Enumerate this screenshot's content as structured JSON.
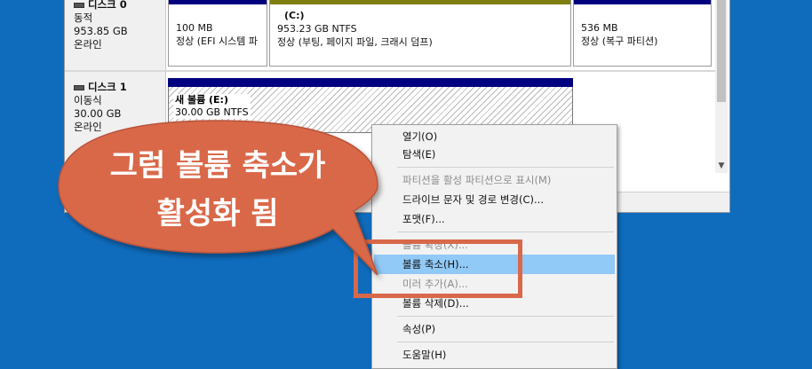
{
  "disk0": {
    "title": "디스크 0",
    "type": "동적",
    "size": "953.85 GB",
    "status": "온라인",
    "partitions": [
      {
        "label": "",
        "size": "100 MB",
        "desc": "정상 (EFI 시스템 파"
      },
      {
        "label": "(C:)",
        "size": "953.23 GB NTFS",
        "desc": "정상 (부팅, 페이지 파일, 크래시 덤프)"
      },
      {
        "label": "",
        "size": "536 MB",
        "desc": "정상 (복구 파티션)"
      }
    ]
  },
  "disk1": {
    "title": "디스크 1",
    "type": "이동식",
    "size": "30.00 GB",
    "status": "온라인",
    "volume": {
      "name": "새 볼륨  (E:)",
      "size": "30.00 GB NTFS"
    }
  },
  "context_menu": {
    "items": [
      {
        "label": "열기(O)",
        "enabled": true
      },
      {
        "label": "탐색(E)",
        "enabled": true
      },
      {
        "label": "파티션을 활성 파티션으로 표시(M)",
        "enabled": false
      },
      {
        "label": "드라이브 문자 및 경로 변경(C)...",
        "enabled": true
      },
      {
        "label": "포맷(F)...",
        "enabled": true
      },
      {
        "label": "볼륨 확장(X)...",
        "enabled": false
      },
      {
        "label": "볼륨 축소(H)...",
        "enabled": true,
        "highlighted": true
      },
      {
        "label": "미러 추가(A)...",
        "enabled": false
      },
      {
        "label": "볼륨 삭제(D)...",
        "enabled": true
      },
      {
        "label": "속성(P)",
        "enabled": true
      },
      {
        "label": "도움말(H)",
        "enabled": true
      }
    ]
  },
  "callout": {
    "line1": "그럼 볼륨 축소가",
    "line2": "활성화 됨",
    "color": "#d9684a"
  },
  "colors": {
    "desktop": "#0f6cbd",
    "partition_bar": "#00007f",
    "menu_highlight": "#91c9f7"
  }
}
